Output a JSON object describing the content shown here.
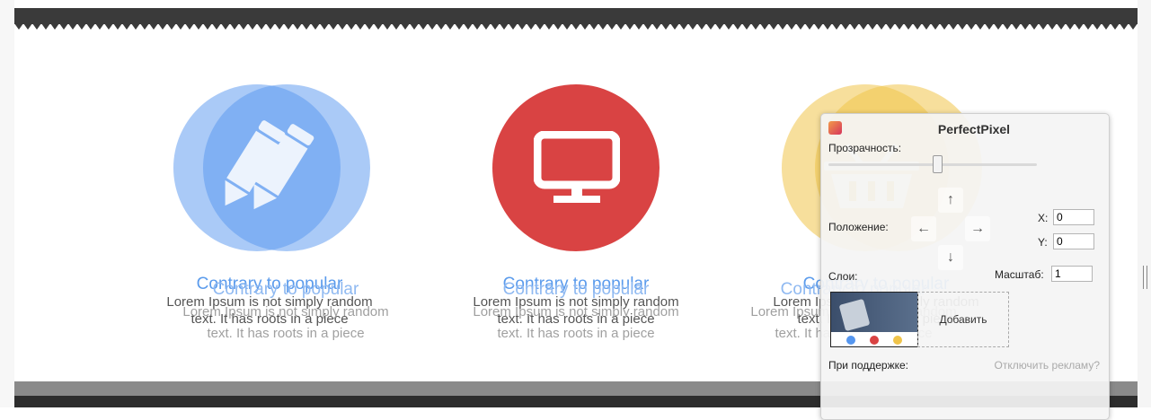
{
  "features": [
    {
      "title": "Contrary to popular",
      "line1": "Lorem Ipsum is not simply random",
      "line2": "text. It has roots in a piece",
      "color": "#5596ef",
      "icon": "pencil-icon"
    },
    {
      "title": "Contrary to popular",
      "line1": "Lorem Ipsum is not simply random",
      "line2": "text. It has roots in a piece",
      "color": "#d94343",
      "icon": "monitor-icon"
    },
    {
      "title": "Contrary to popular",
      "line1": "Lorem Ipsum is not simply random",
      "line2": "text. It has roots in a piece",
      "color": "#f0c44a",
      "icon": "basket-icon"
    }
  ],
  "perfectpixel": {
    "title": "PerfectPixel",
    "opacity_label": "Прозрачность:",
    "position_label": "Положение:",
    "x_label": "X:",
    "x_value": "0",
    "y_label": "Y:",
    "y_value": "0",
    "layers_label": "Слои:",
    "scale_label": "Масштаб:",
    "scale_value": "1",
    "add_label": "Добавить",
    "support_label": "При поддержке:",
    "disable_ads": "Отключить рекламу?",
    "arrows": {
      "up": "↑",
      "left": "←",
      "right": "→",
      "down": "↓"
    }
  }
}
